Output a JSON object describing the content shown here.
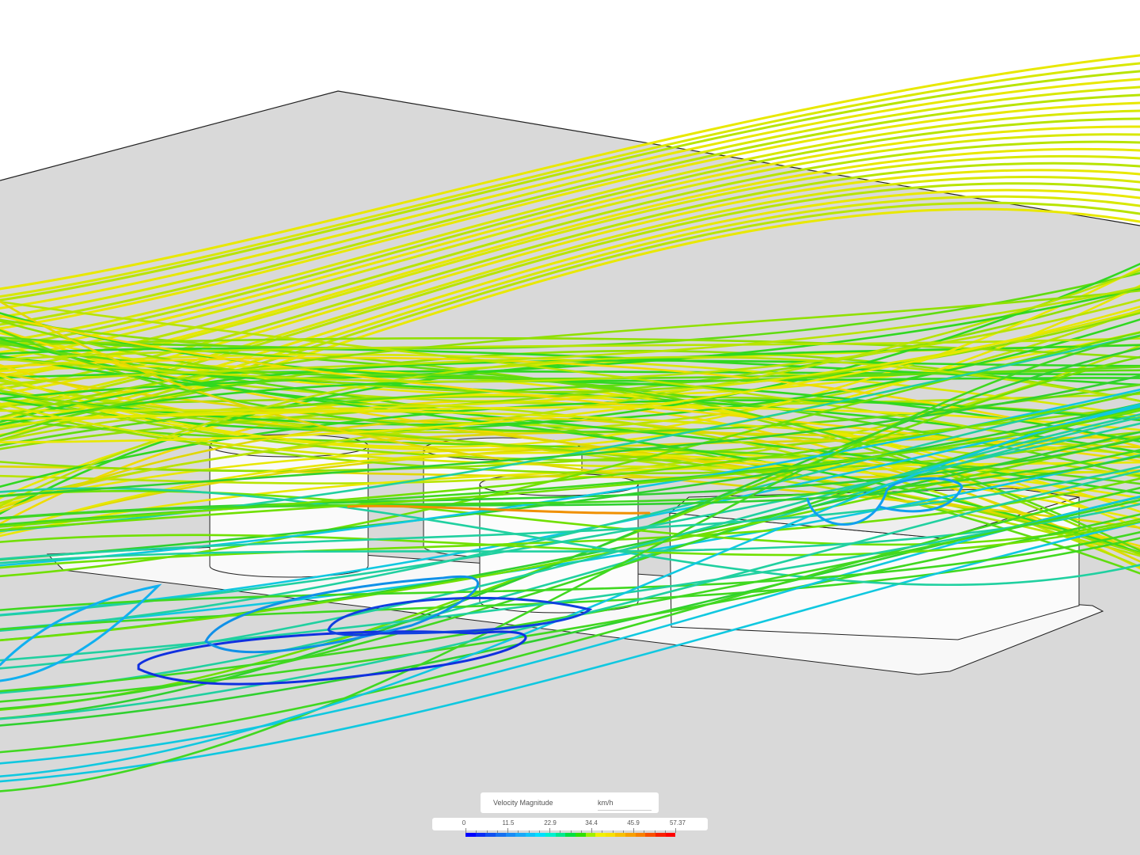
{
  "legend": {
    "title": "Velocity Magnitude",
    "unit": "km/h",
    "ticks": [
      "0",
      "11.5",
      "22.9",
      "34.4",
      "45.9",
      "57.37"
    ],
    "min": 0,
    "max": 57.37,
    "colors": [
      "#0000ff",
      "#0a2cf5",
      "#1050f0",
      "#1670f0",
      "#1a8cf5",
      "#1aa8f8",
      "#10c4fa",
      "#00e0ff",
      "#00f0d0",
      "#00e890",
      "#00e040",
      "#30e000",
      "#a0f000",
      "#f0f000",
      "#f8e000",
      "#f8c000",
      "#f8a000",
      "#f88000",
      "#f85000",
      "#f82000",
      "#ff0000"
    ]
  }
}
